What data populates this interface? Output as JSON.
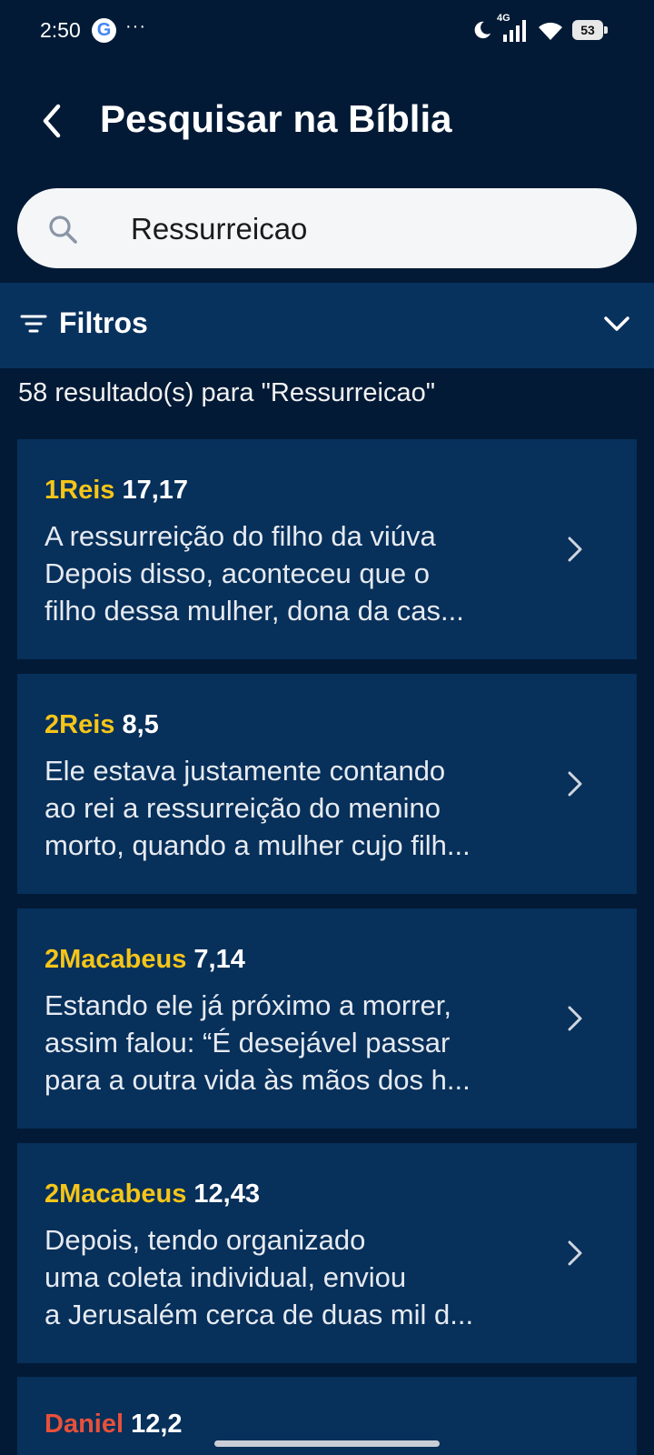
{
  "status_bar": {
    "time": "2:50",
    "google_badge": "G",
    "more": "···",
    "network": "4G",
    "battery": "53"
  },
  "header": {
    "back_icon": "chevron-left-icon",
    "title": "Pesquisar na Bíblia"
  },
  "search": {
    "icon": "search-icon",
    "value": "Ressurreicao",
    "placeholder": ""
  },
  "filters": {
    "icon": "filter-icon",
    "label": "Filtros",
    "toggle_icon": "chevron-down-icon"
  },
  "results": {
    "count_text": "58 resultado(s) para \"Ressurreicao\"",
    "items": [
      {
        "book": "1Reis",
        "verse": "17,17",
        "lines": [
          "A ressurreição do filho da viúva",
          "Depois disso, aconteceu que o",
          "filho dessa mulher, dona da cas..."
        ]
      },
      {
        "book": "2Reis",
        "verse": "8,5",
        "lines": [
          "Ele estava justamente contando",
          "ao rei a ressurreição do menino",
          "morto, quando a mulher cujo filh..."
        ]
      },
      {
        "book": "2Macabeus",
        "verse": "7,14",
        "lines": [
          "Estando ele já próximo a morrer,",
          "assim falou: “É desejável passar",
          "para a outra vida às mãos dos h..."
        ]
      },
      {
        "book": "2Macabeus",
        "verse": "12,43",
        "lines": [
          "Depois, tendo organizado",
          "uma coleta individual, enviou",
          "a Jerusalém cerca de duas mil d..."
        ]
      },
      {
        "book": "Daniel",
        "verse": "12,2",
        "lines": []
      }
    ]
  },
  "colors": {
    "background": "#021a36",
    "card": "#07305b",
    "filters_bar": "#08325e",
    "book_highlight": "#f5c518",
    "book_highlight_alt": "#e8503a"
  }
}
